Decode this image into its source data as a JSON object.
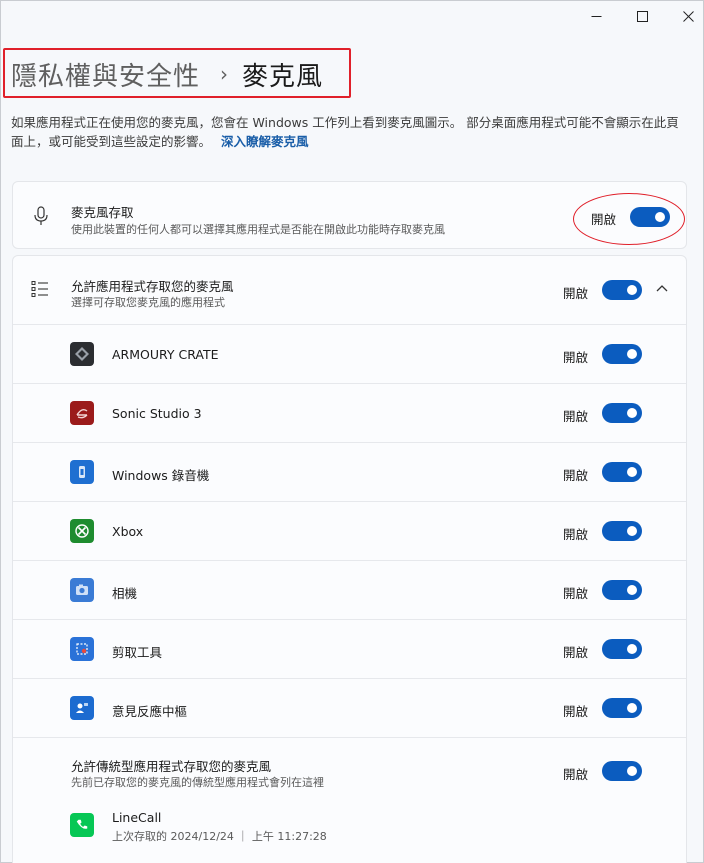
{
  "window": {
    "min_glyph": "—",
    "max_glyph": "□",
    "close_glyph": "✕"
  },
  "breadcrumb": {
    "parent": "隱私權與安全性",
    "separator": "›",
    "current": "麥克風"
  },
  "description": {
    "text": "如果應用程式正在使用您的麥克風，您會在 Windows 工作列上看到麥克風圖示。 部分桌面應用程式可能不會顯示在此頁面上，或可能受到這些設定的影響。",
    "link": "深入瞭解麥克風"
  },
  "microphone_access": {
    "title": "麥克風存取",
    "subtitle": "使用此裝置的任何人都可以選擇其應用程式是否能在開啟此功能時存取麥克風",
    "state": "開啟",
    "icon": "microphone-icon"
  },
  "app_access": {
    "title": "允許應用程式存取您的麥克風",
    "subtitle": "選擇可存取您麥克風的應用程式",
    "state": "開啟",
    "icon": "list-icon"
  },
  "apps": [
    {
      "name": "ARMOURY CRATE",
      "state": "開啟",
      "icon": "armoury-crate-icon",
      "color": "#2b2d31"
    },
    {
      "name": "Sonic Studio 3",
      "state": "開啟",
      "icon": "sonic-studio-icon",
      "color": "#9b1b1b"
    },
    {
      "name": "Windows 錄音機",
      "state": "開啟",
      "icon": "voice-recorder-icon",
      "color": "#1f6fd1"
    },
    {
      "name": "Xbox",
      "state": "開啟",
      "icon": "xbox-icon",
      "color": "#1e8c2f"
    },
    {
      "name": "相機",
      "state": "開啟",
      "icon": "camera-icon",
      "color": "#3a7bd5"
    },
    {
      "name": "剪取工具",
      "state": "開啟",
      "icon": "snipping-tool-icon",
      "color": "#2a72d8"
    },
    {
      "name": "意見反應中樞",
      "state": "開啟",
      "icon": "feedback-hub-icon",
      "color": "#1c6bd0"
    }
  ],
  "desktop_apps": {
    "title": "允許傳統型應用程式存取您的麥克風",
    "subtitle": "先前已存取您的麥克風的傳統型應用程式會列在這裡",
    "state": "開啟"
  },
  "linecall": {
    "name": "LineCall",
    "last_access": "上次存取的 2024/12/24 ｜ 上午 11:27:28",
    "icon": "line-call-icon",
    "color": "#06c755"
  }
}
